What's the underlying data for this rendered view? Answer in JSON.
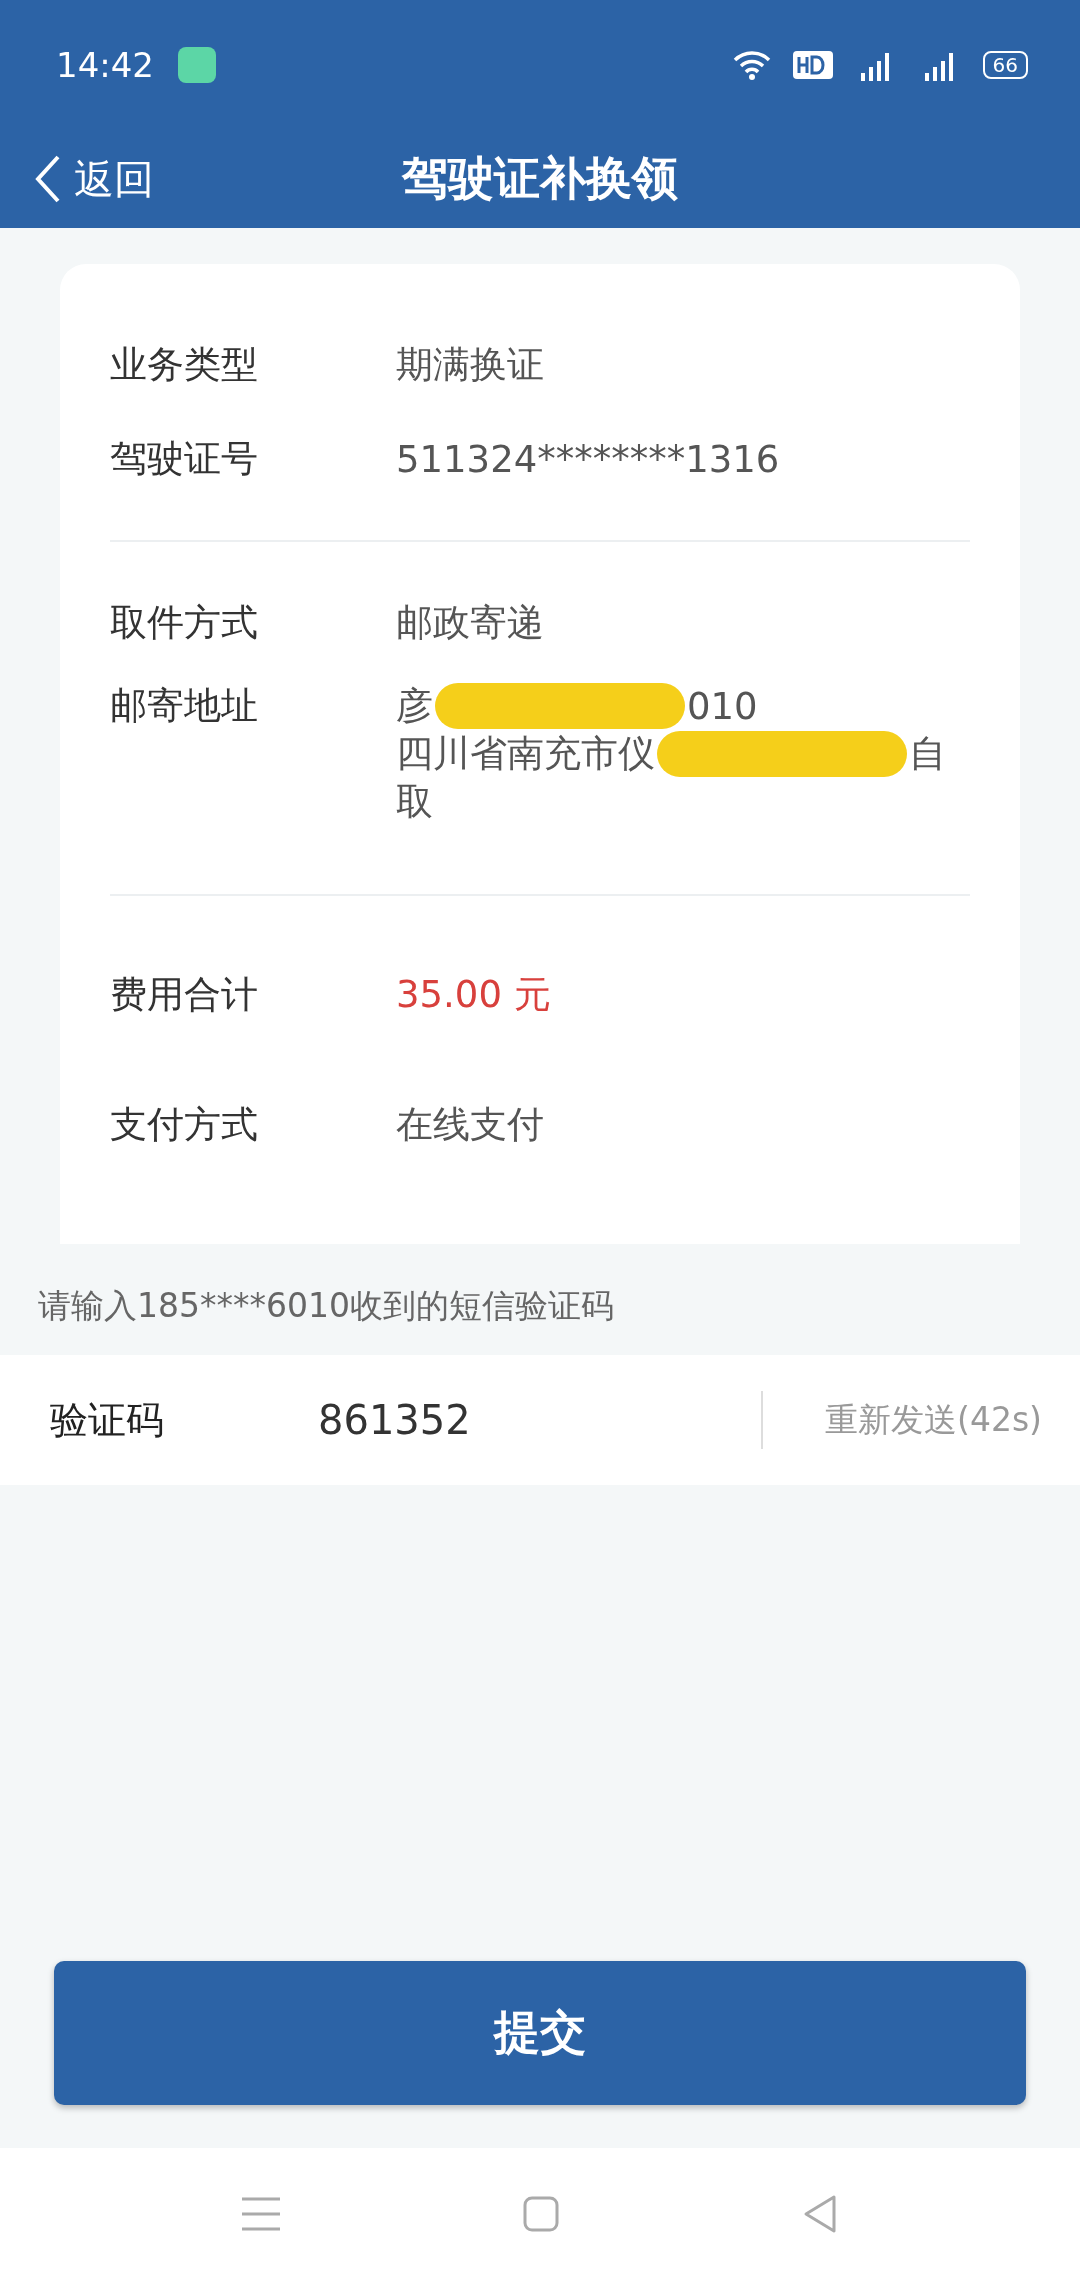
{
  "status_bar": {
    "time": "14:42",
    "battery": "66"
  },
  "header": {
    "back": "返回",
    "title": "驾驶证补换领"
  },
  "sections": [
    {
      "rows": [
        {
          "label": "业务类型",
          "value": "期满换证"
        },
        {
          "label": "驾驶证号",
          "value": "511324********1316"
        }
      ]
    },
    {
      "rows": [
        {
          "label": "取件方式",
          "value": "邮政寄递"
        }
      ],
      "address": {
        "label": "邮寄地址",
        "lines": [
          [
            {
              "kind": "text",
              "text": "彦"
            },
            {
              "kind": "redacted"
            },
            {
              "kind": "text",
              "text": "010"
            }
          ],
          [
            {
              "kind": "text",
              "text": "四川省南充市仪"
            },
            {
              "kind": "redacted"
            },
            {
              "kind": "text",
              "text": "自"
            }
          ],
          [
            {
              "kind": "text",
              "text": "取"
            }
          ]
        ]
      }
    },
    {
      "rows": [
        {
          "label": "费用合计",
          "value": "35.00 元",
          "kind": "price"
        },
        {
          "label": "支付方式",
          "value": "在线支付"
        }
      ]
    }
  ],
  "sms_hint": "请输入185****6010收到的短信验证码",
  "code_field": {
    "label": "验证码",
    "value": "861352",
    "resend": "重新发送(42s)"
  },
  "submit": "提交"
}
